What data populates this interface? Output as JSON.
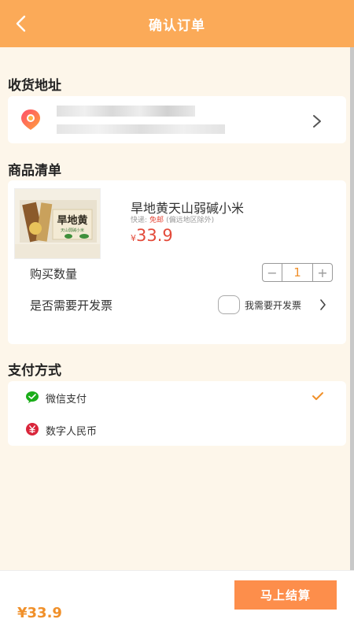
{
  "header": {
    "title": "确认订单"
  },
  "address": {
    "section_title": "收货地址",
    "line1": "",
    "line2": ""
  },
  "goods": {
    "section_title": "商品清单",
    "product_name": "旱地黄天山弱碱小米",
    "image_text": "旱地黄",
    "image_subtext": "天山弱碱小米",
    "shipping_prefix": "快递:",
    "shipping_free": "免邮",
    "shipping_note": "(偏远地区除外)",
    "currency_symbol": "¥",
    "price": "33.9",
    "quantity_label": "购买数量",
    "quantity": "1",
    "minus": "−",
    "plus": "+",
    "invoice_label": "是否需要开发票",
    "invoice_option": "我需要开发票"
  },
  "payment": {
    "section_title": "支付方式",
    "methods": [
      {
        "label": "微信支付",
        "icon": "wechat-pay-icon",
        "selected": true
      },
      {
        "label": "数字人民币",
        "icon": "digital-rmb-icon",
        "selected": false
      }
    ]
  },
  "footer": {
    "total": "¥33.9",
    "submit_label": "马上结算"
  },
  "colors": {
    "header": "#fbaa58",
    "background": "#fdf6ea",
    "price": "#e34a3a",
    "accent": "#f0902a",
    "submit": "#fd8e4b"
  }
}
